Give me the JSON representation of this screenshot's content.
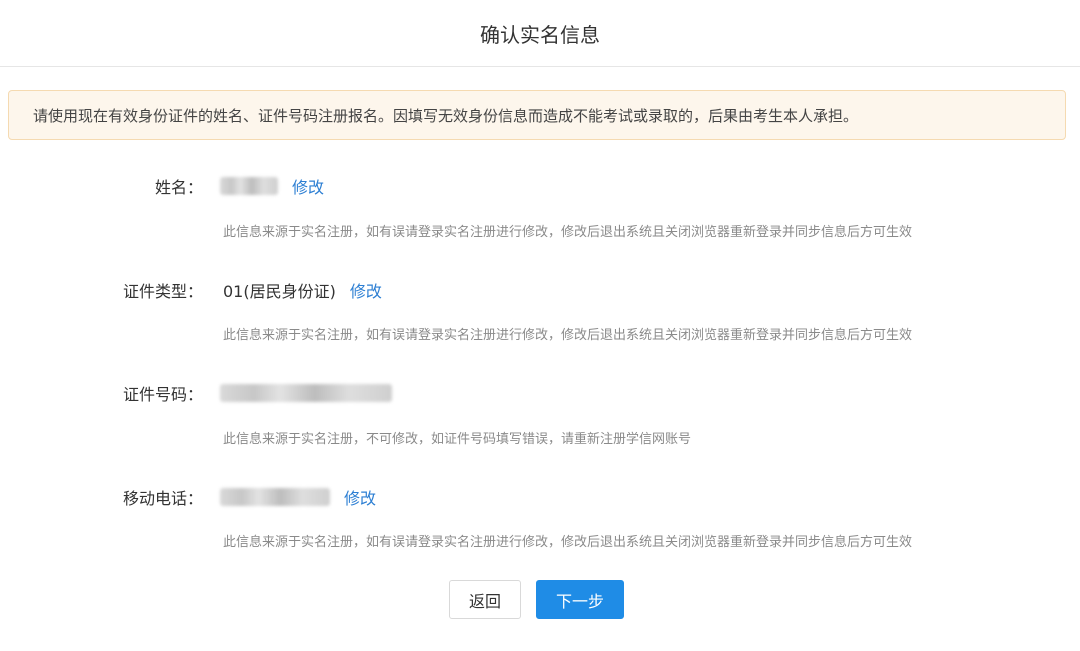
{
  "header": {
    "title": "确认实名信息"
  },
  "notice": {
    "text": "请使用现在有效身份证件的姓名、证件号码注册报名。因填写无效身份信息而造成不能考试或录取的，后果由考生本人承担。"
  },
  "fields": {
    "name": {
      "label": "姓名：",
      "edit_label": "修改",
      "hint": "此信息来源于实名注册，如有误请登录实名注册进行修改，修改后退出系统且关闭浏览器重新登录并同步信息后方可生效"
    },
    "id_type": {
      "label": "证件类型：",
      "value": "01(居民身份证)",
      "edit_label": "修改",
      "hint": "此信息来源于实名注册，如有误请登录实名注册进行修改，修改后退出系统且关闭浏览器重新登录并同步信息后方可生效"
    },
    "id_number": {
      "label": "证件号码：",
      "hint": "此信息来源于实名注册，不可修改，如证件号码填写错误，请重新注册学信网账号"
    },
    "mobile": {
      "label": "移动电话：",
      "edit_label": "修改",
      "hint": "此信息来源于实名注册，如有误请登录实名注册进行修改，修改后退出系统且关闭浏览器重新登录并同步信息后方可生效"
    }
  },
  "actions": {
    "back_label": "返回",
    "next_label": "下一步"
  },
  "colors": {
    "link": "#2d7fd3",
    "primary_button": "#1f8ce6",
    "notice_bg": "#fdf6ec",
    "notice_border": "#f5dab1"
  }
}
